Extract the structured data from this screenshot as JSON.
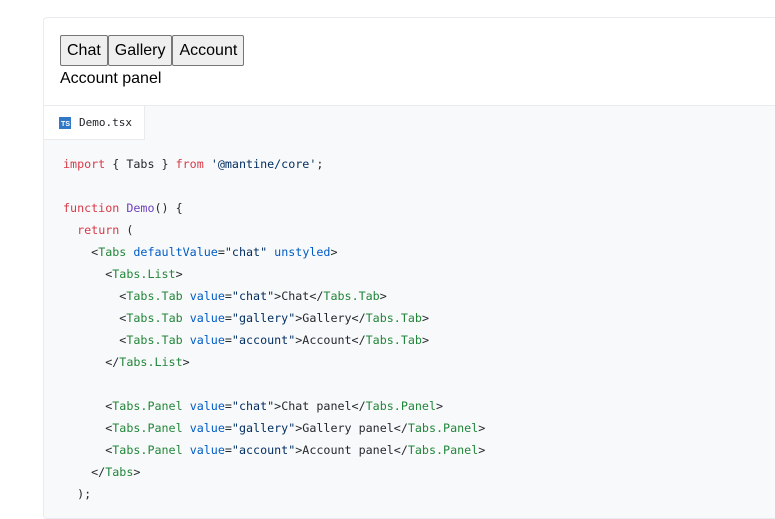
{
  "preview": {
    "tabs": [
      {
        "label": "Chat"
      },
      {
        "label": "Gallery"
      },
      {
        "label": "Account"
      }
    ],
    "active_panel_text": "Account panel"
  },
  "code": {
    "file_icon": "TS",
    "file_name": "Demo.tsx",
    "lines": [
      [
        {
          "t": "import",
          "c": "kw"
        },
        {
          "t": " { Tabs } ",
          "c": "plain"
        },
        {
          "t": "from",
          "c": "kw"
        },
        {
          "t": " ",
          "c": "plain"
        },
        {
          "t": "'@mantine/core'",
          "c": "str"
        },
        {
          "t": ";",
          "c": "plain"
        }
      ],
      [],
      [
        {
          "t": "function",
          "c": "kw"
        },
        {
          "t": " ",
          "c": "plain"
        },
        {
          "t": "Demo",
          "c": "fn"
        },
        {
          "t": "() {",
          "c": "plain"
        }
      ],
      [
        {
          "t": "  ",
          "c": "plain"
        },
        {
          "t": "return",
          "c": "kw"
        },
        {
          "t": " (",
          "c": "plain"
        }
      ],
      [
        {
          "t": "    <",
          "c": "plain"
        },
        {
          "t": "Tabs",
          "c": "tag"
        },
        {
          "t": " ",
          "c": "plain"
        },
        {
          "t": "defaultValue",
          "c": "attr"
        },
        {
          "t": "=",
          "c": "plain"
        },
        {
          "t": "\"chat\"",
          "c": "str"
        },
        {
          "t": " ",
          "c": "plain"
        },
        {
          "t": "unstyled",
          "c": "attr"
        },
        {
          "t": ">",
          "c": "plain"
        }
      ],
      [
        {
          "t": "      <",
          "c": "plain"
        },
        {
          "t": "Tabs.List",
          "c": "tag"
        },
        {
          "t": ">",
          "c": "plain"
        }
      ],
      [
        {
          "t": "        <",
          "c": "plain"
        },
        {
          "t": "Tabs.Tab",
          "c": "tag"
        },
        {
          "t": " ",
          "c": "plain"
        },
        {
          "t": "value",
          "c": "attr"
        },
        {
          "t": "=",
          "c": "plain"
        },
        {
          "t": "\"chat\"",
          "c": "str"
        },
        {
          "t": ">Chat</",
          "c": "plain"
        },
        {
          "t": "Tabs.Tab",
          "c": "tag"
        },
        {
          "t": ">",
          "c": "plain"
        }
      ],
      [
        {
          "t": "        <",
          "c": "plain"
        },
        {
          "t": "Tabs.Tab",
          "c": "tag"
        },
        {
          "t": " ",
          "c": "plain"
        },
        {
          "t": "value",
          "c": "attr"
        },
        {
          "t": "=",
          "c": "plain"
        },
        {
          "t": "\"gallery\"",
          "c": "str"
        },
        {
          "t": ">Gallery</",
          "c": "plain"
        },
        {
          "t": "Tabs.Tab",
          "c": "tag"
        },
        {
          "t": ">",
          "c": "plain"
        }
      ],
      [
        {
          "t": "        <",
          "c": "plain"
        },
        {
          "t": "Tabs.Tab",
          "c": "tag"
        },
        {
          "t": " ",
          "c": "plain"
        },
        {
          "t": "value",
          "c": "attr"
        },
        {
          "t": "=",
          "c": "plain"
        },
        {
          "t": "\"account\"",
          "c": "str"
        },
        {
          "t": ">Account</",
          "c": "plain"
        },
        {
          "t": "Tabs.Tab",
          "c": "tag"
        },
        {
          "t": ">",
          "c": "plain"
        }
      ],
      [
        {
          "t": "      </",
          "c": "plain"
        },
        {
          "t": "Tabs.List",
          "c": "tag"
        },
        {
          "t": ">",
          "c": "plain"
        }
      ],
      [],
      [
        {
          "t": "      <",
          "c": "plain"
        },
        {
          "t": "Tabs.Panel",
          "c": "tag"
        },
        {
          "t": " ",
          "c": "plain"
        },
        {
          "t": "value",
          "c": "attr"
        },
        {
          "t": "=",
          "c": "plain"
        },
        {
          "t": "\"chat\"",
          "c": "str"
        },
        {
          "t": ">Chat panel</",
          "c": "plain"
        },
        {
          "t": "Tabs.Panel",
          "c": "tag"
        },
        {
          "t": ">",
          "c": "plain"
        }
      ],
      [
        {
          "t": "      <",
          "c": "plain"
        },
        {
          "t": "Tabs.Panel",
          "c": "tag"
        },
        {
          "t": " ",
          "c": "plain"
        },
        {
          "t": "value",
          "c": "attr"
        },
        {
          "t": "=",
          "c": "plain"
        },
        {
          "t": "\"gallery\"",
          "c": "str"
        },
        {
          "t": ">Gallery panel</",
          "c": "plain"
        },
        {
          "t": "Tabs.Panel",
          "c": "tag"
        },
        {
          "t": ">",
          "c": "plain"
        }
      ],
      [
        {
          "t": "      <",
          "c": "plain"
        },
        {
          "t": "Tabs.Panel",
          "c": "tag"
        },
        {
          "t": " ",
          "c": "plain"
        },
        {
          "t": "value",
          "c": "attr"
        },
        {
          "t": "=",
          "c": "plain"
        },
        {
          "t": "\"account\"",
          "c": "str"
        },
        {
          "t": ">Account panel</",
          "c": "plain"
        },
        {
          "t": "Tabs.Panel",
          "c": "tag"
        },
        {
          "t": ">",
          "c": "plain"
        }
      ],
      [
        {
          "t": "    </",
          "c": "plain"
        },
        {
          "t": "Tabs",
          "c": "tag"
        },
        {
          "t": ">",
          "c": "plain"
        }
      ],
      [
        {
          "t": "  );",
          "c": "plain"
        }
      ]
    ]
  }
}
